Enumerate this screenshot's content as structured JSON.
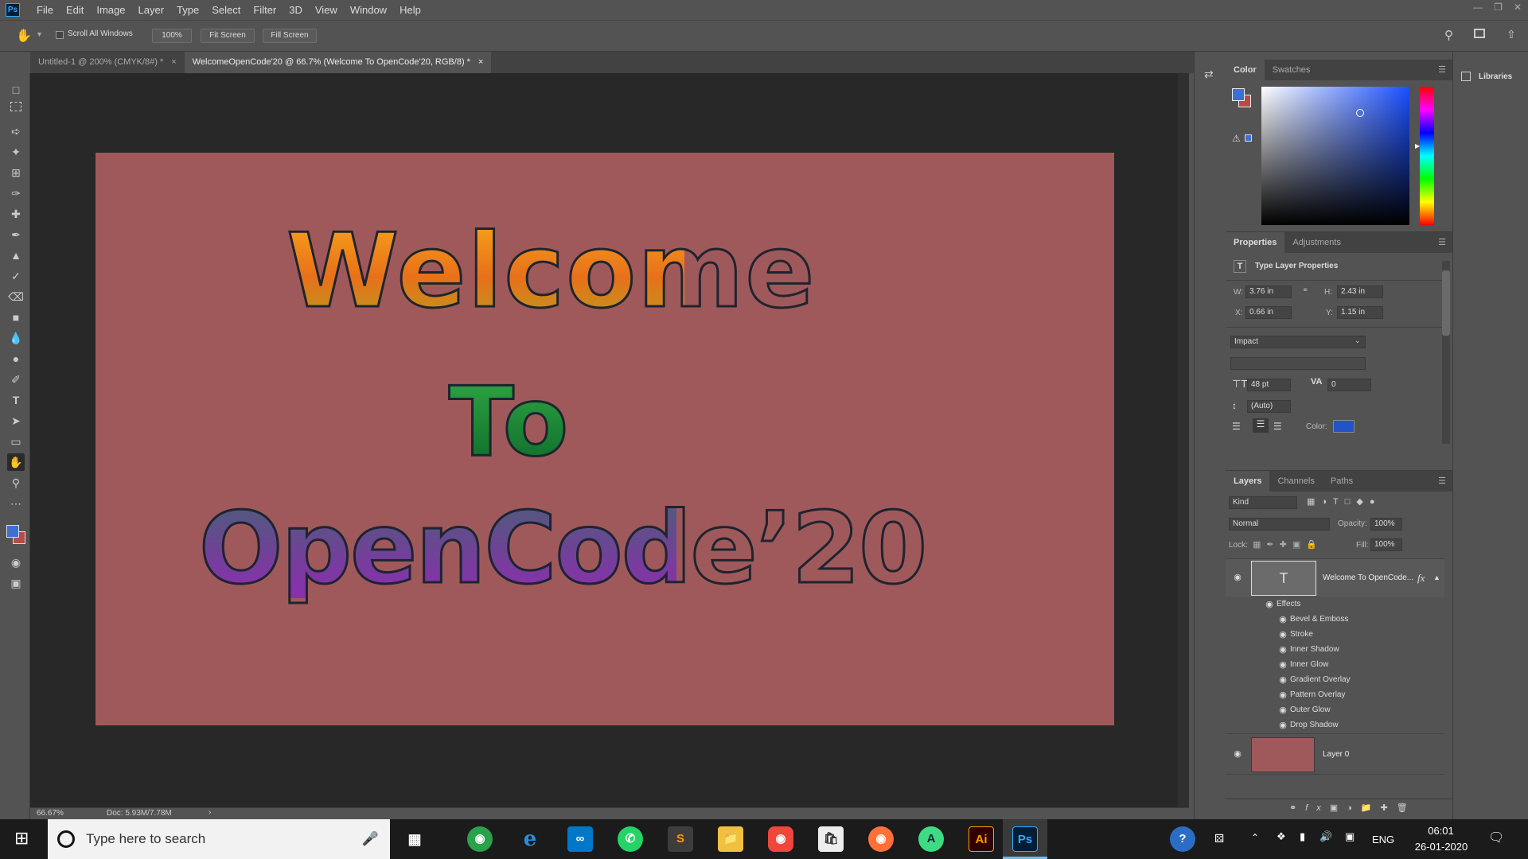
{
  "app": {
    "logo": "Ps"
  },
  "menu": [
    "File",
    "Edit",
    "Image",
    "Layer",
    "Type",
    "Select",
    "Filter",
    "3D",
    "View",
    "Window",
    "Help"
  ],
  "options": {
    "scroll_all": "Scroll All Windows",
    "zoom_btn": "100%",
    "fit_btn": "Fit Screen",
    "fill_btn": "Fill Screen"
  },
  "tabs": [
    {
      "label": "Untitled-1 @ 200% (CMYK/8#) *",
      "close": "×"
    },
    {
      "label": "WelcomeOpenCode'20 @ 66.7% (Welcome To OpenCode'20, RGB/8) *",
      "close": "×"
    }
  ],
  "canvas": {
    "line1": "Welcome",
    "line2": "To",
    "line3": "OpenCode’20",
    "bg_color": "#a0595a"
  },
  "status": {
    "zoom": "66.67%",
    "doc": "Doc: 5.93M/7.78M"
  },
  "color_panel": {
    "tab_color": "Color",
    "tab_swatches": "Swatches",
    "fg": "#3d6fd6",
    "bg": "#b84a4a"
  },
  "properties": {
    "tab_properties": "Properties",
    "tab_adjustments": "Adjustments",
    "title": "Type Layer Properties",
    "w_label": "W:",
    "w": "3.76 in",
    "h_label": "H:",
    "h": "2.43 in",
    "x_label": "X:",
    "x": "0.66 in",
    "y_label": "Y:",
    "y": "1.15 in",
    "font": "Impact",
    "size": "48 pt",
    "tracking": "0",
    "leading": "(Auto)",
    "color_label": "Color:",
    "text_color": "#2353c6"
  },
  "layers": {
    "tab_layers": "Layers",
    "tab_channels": "Channels",
    "tab_paths": "Paths",
    "filter": "Kind",
    "blend": "Normal",
    "opacity_label": "Opacity:",
    "opacity": "100%",
    "lock_label": "Lock:",
    "fill_label": "Fill:",
    "fill": "100%",
    "text_layer": "Welcome To OpenCode...",
    "fx": "fx",
    "effects_label": "Effects",
    "effects": [
      "Bevel & Emboss",
      "Stroke",
      "Inner Shadow",
      "Inner Glow",
      "Gradient Overlay",
      "Pattern Overlay",
      "Outer Glow",
      "Drop Shadow"
    ],
    "layer0": "Layer 0"
  },
  "libraries": {
    "label": "Libraries"
  },
  "taskbar": {
    "search_placeholder": "Type here to search",
    "lang": "ENG",
    "time": "06:01",
    "date": "26-01-2020"
  }
}
